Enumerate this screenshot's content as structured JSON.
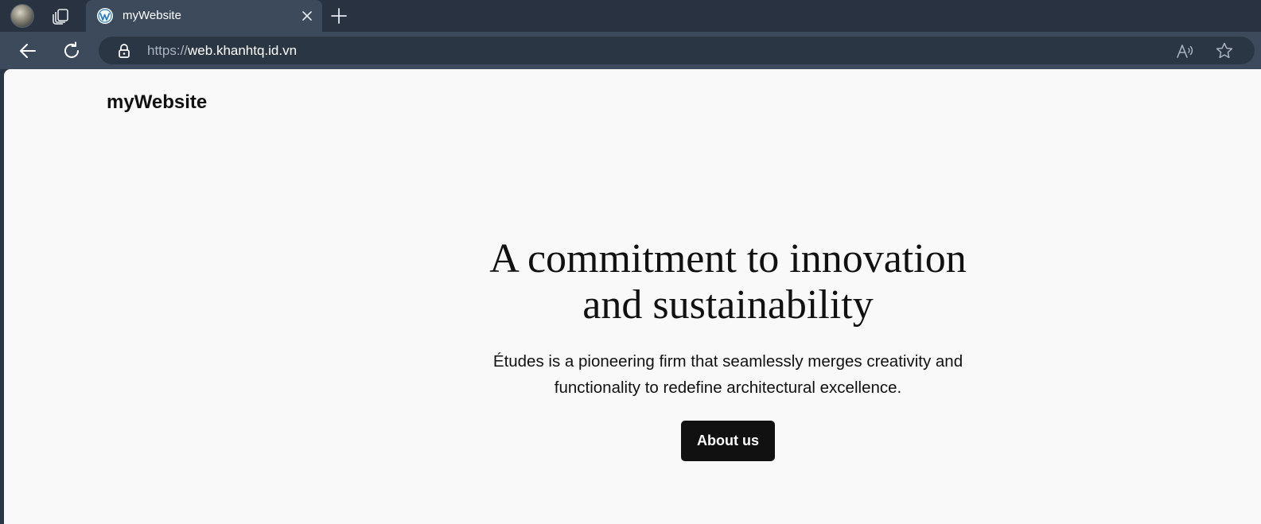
{
  "browser": {
    "tab": {
      "title": "myWebsite",
      "favicon": "wordpress-icon"
    },
    "address": {
      "scheme": "https://",
      "host": "web.khanhtq.id.vn"
    },
    "icons": {
      "profile": "profile-avatar",
      "collections": "tab-actions-icon",
      "close": "close-icon",
      "new_tab": "plus-icon",
      "back": "back-arrow-icon",
      "refresh": "refresh-icon",
      "lock": "lock-icon",
      "read_aloud": "read-aloud-icon",
      "favorite": "star-icon"
    },
    "colors": {
      "tabstrip": "#283240",
      "toolbar": "#3d4a5c",
      "addressbar": "#2b3644"
    }
  },
  "page": {
    "site_title": "myWebsite",
    "hero": {
      "heading_line1": "A commitment to innovation",
      "heading_line2": "and sustainability",
      "text_line1": "Études is a pioneering firm that seamlessly merges creativity and",
      "text_line2": "functionality to redefine architectural excellence.",
      "button_label": "About us"
    },
    "colors": {
      "background": "#f9f9f9",
      "text": "#111111",
      "button_bg": "#111111",
      "button_text": "#ffffff"
    }
  }
}
